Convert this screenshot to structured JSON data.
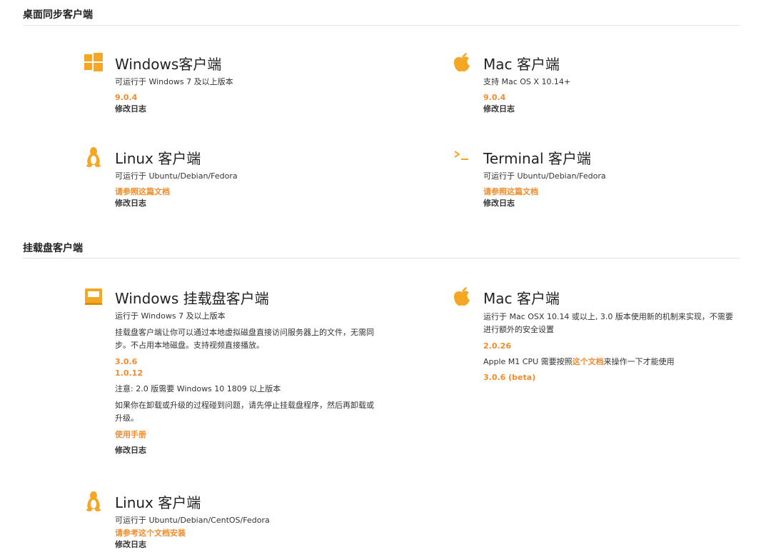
{
  "colors": {
    "accent": "#f08c2e",
    "text": "#333333",
    "divider": "#e3e3e3"
  },
  "sections": [
    {
      "title": "桌面同步客户端",
      "clients": [
        {
          "icon": "windows-icon",
          "name": "Windows客户端",
          "desc": "可运行于 Windows 7 及以上版本",
          "version": "9.0.4",
          "changelog": "修改日志"
        },
        {
          "icon": "apple-icon",
          "name": "Mac 客户端",
          "desc": "支持 Mac OS X 10.14+",
          "version": "9.0.4",
          "changelog": "修改日志"
        },
        {
          "icon": "linux-icon",
          "name": "Linux 客户端",
          "desc": "可运行于 Ubuntu/Debian/Fedora",
          "doc_link": "请参照这篇文档",
          "changelog": "修改日志"
        },
        {
          "icon": "terminal-icon",
          "name": "Terminal 客户端",
          "desc": "可运行于 Ubuntu/Debian/Fedora",
          "doc_link": "请参照这篇文档",
          "changelog": "修改日志"
        }
      ]
    },
    {
      "title": "挂载盘客户端",
      "clients": [
        {
          "icon": "drive-icon",
          "name": "Windows 挂载盘客户端",
          "desc": "运行于 Windows 7 及以上版本",
          "intro": "挂载盘客户端让你可以通过本地虚拟磁盘直接访问服务器上的文件，无需同步。不占用本地磁盘。支持视频直接播放。",
          "versions": [
            "3.0.6",
            "1.0.12"
          ],
          "note": "注意: 2.0 版需要 Windows 10 1809 以上版本",
          "trouble": "如果你在卸载或升级的过程碰到问题，请先停止挂载盘程序，然后再卸载或升级。",
          "manual": "使用手册",
          "changelog": "修改日志"
        },
        {
          "icon": "apple-icon",
          "name": "Mac 客户端",
          "desc": "运行于 Mac OSX 10.14 或以上, 3.0 版本使用新的机制来实现，不需要进行额外的安全设置",
          "version": "2.0.26",
          "m1_before": "Apple M1 CPU 需要按照",
          "m1_link": "这个文档",
          "m1_after": "来操作一下才能使用",
          "beta": "3.0.6 (beta)"
        },
        {
          "icon": "linux-icon",
          "name": "Linux 客户端",
          "desc": "可运行于 Ubuntu/Debian/CentOS/Fedora",
          "doc_link": "请参考这个文档安装",
          "changelog": "修改日志"
        }
      ]
    }
  ]
}
